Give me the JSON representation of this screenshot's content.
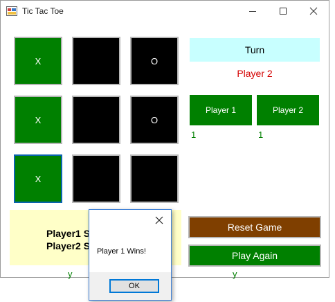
{
  "window": {
    "title": "Tic Tac Toe"
  },
  "board": {
    "cells": [
      {
        "mark": "X",
        "color": "#008000"
      },
      {
        "mark": "",
        "color": "#000000"
      },
      {
        "mark": "O",
        "color": "#000000"
      },
      {
        "mark": "X",
        "color": "#008000"
      },
      {
        "mark": "",
        "color": "#000000"
      },
      {
        "mark": "O",
        "color": "#000000"
      },
      {
        "mark": "X",
        "color": "#008000"
      },
      {
        "mark": "",
        "color": "#000000"
      },
      {
        "mark": "",
        "color": "#000000"
      }
    ]
  },
  "turn": {
    "label": "Turn",
    "value": "Player 2"
  },
  "players": {
    "p1": {
      "label": "Player 1",
      "score": "1"
    },
    "p2": {
      "label": "Player 2",
      "score": "1"
    }
  },
  "score_panel": {
    "line1": "Player1 S",
    "line2": "Player2 S"
  },
  "actions": {
    "reset": {
      "label": "Reset Game",
      "color": "#7f3f00"
    },
    "play_again": {
      "label": "Play Again",
      "color": "#008000"
    }
  },
  "below": {
    "left": "y",
    "right": "y"
  },
  "dialog": {
    "message": "Player 1 Wins!",
    "ok_label": "OK"
  }
}
